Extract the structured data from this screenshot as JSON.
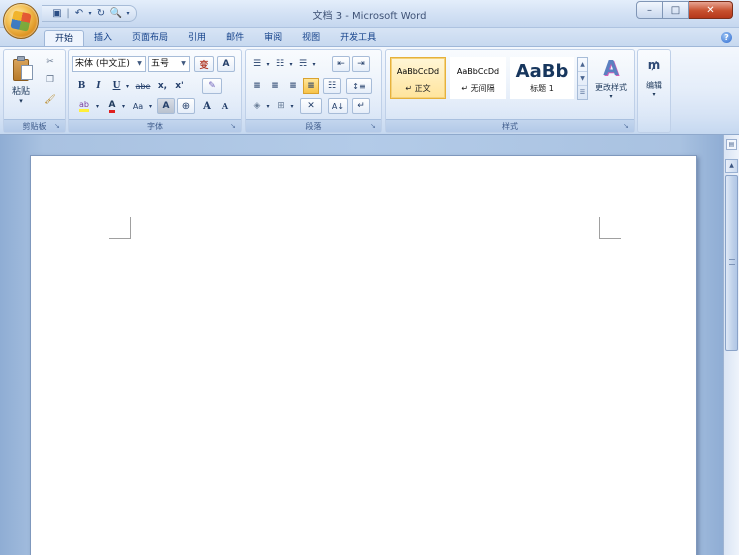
{
  "window": {
    "title": "文档 3 - Microsoft Word",
    "quick_access": [
      "save-icon",
      "undo-icon",
      "redo-icon",
      "print-preview-icon"
    ],
    "controls": {
      "minimize": "–",
      "maximize": "□",
      "close": "✕"
    }
  },
  "tabs": [
    {
      "label": "开始",
      "active": true
    },
    {
      "label": "插入"
    },
    {
      "label": "页面布局"
    },
    {
      "label": "引用"
    },
    {
      "label": "邮件"
    },
    {
      "label": "审阅"
    },
    {
      "label": "视图"
    },
    {
      "label": "开发工具"
    }
  ],
  "ribbon": {
    "clipboard": {
      "label": "剪贴板",
      "paste": "粘贴",
      "paste_arrow": "▾"
    },
    "font": {
      "label": "字体",
      "font_name": "宋体 (中文正)",
      "font_size": "五号",
      "phonetic": "变",
      "border_char": "A",
      "bold": "B",
      "italic": "I",
      "underline": "U",
      "strikethrough": "abe",
      "subscript": "x,",
      "superscript": "x'",
      "clear_format": "✎",
      "highlight": "ab",
      "font_color": "A",
      "change_case": "Aa",
      "shading_char": "A",
      "enclose_char": "⊕",
      "grow_font": "A",
      "shrink_font": "A"
    },
    "paragraph": {
      "label": "段落",
      "bullets": "☰",
      "numbering": "☷",
      "multilevel": "☴",
      "decrease_indent": "⇤",
      "increase_indent": "⇥",
      "align_left": "≡",
      "center": "≡",
      "align_right": "≡",
      "justify": "≡",
      "distributed": "☷",
      "line_spacing": "↕≡",
      "shading": "◈",
      "borders": "⊞",
      "chinese_layout": "✕",
      "sort": "A↓",
      "show_marks": "↵"
    },
    "styles": {
      "label": "样式",
      "cards": [
        {
          "sample": "AaBbCcDd",
          "name": "↵ 正文",
          "selected": true
        },
        {
          "sample": "AaBbCcDd",
          "name": "↵ 无间隔",
          "selected": false
        },
        {
          "sample": "AaBb",
          "name": "标题 1",
          "selected": false
        }
      ],
      "change_styles": "更改样式"
    },
    "editing": {
      "label": "编辑",
      "icon": "binoculars-icon"
    }
  },
  "document": {
    "content": ""
  }
}
